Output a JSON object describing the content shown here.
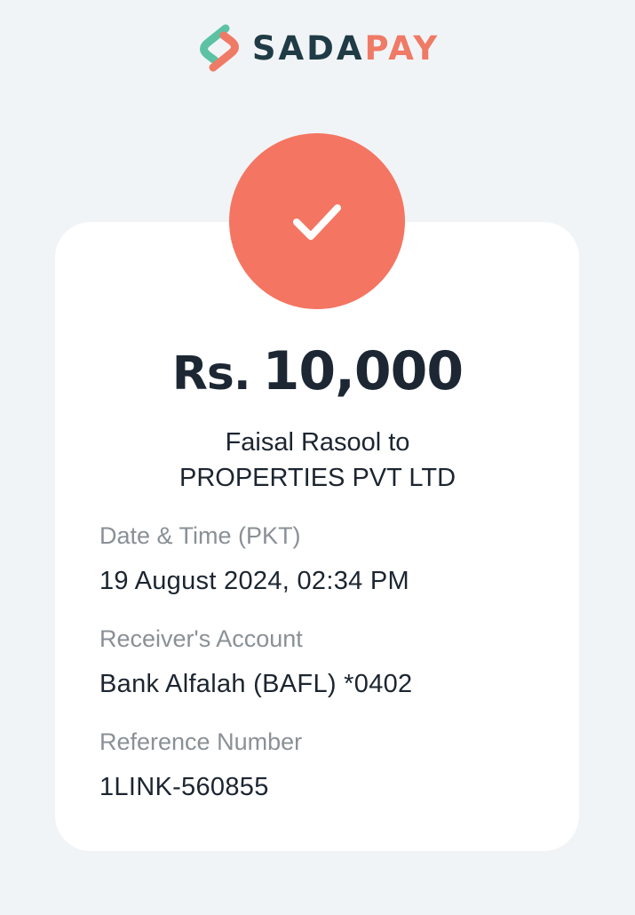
{
  "brand": {
    "logo_part_1": "SADA",
    "logo_part_2": "PAY",
    "primary_color": "#1f3b46",
    "accent_color": "#ef7a66",
    "logo_teal": "#5cc2a3"
  },
  "status": {
    "icon": "check-icon",
    "color": "#f47562"
  },
  "transaction": {
    "currency": "Rs.",
    "amount": "10,000",
    "sender": "Faisal Rasool",
    "connector": "to",
    "receiver": "PROPERTIES PVT LTD"
  },
  "details": [
    {
      "label": "Date & Time (PKT)",
      "value": "19 August 2024, 02:34 PM"
    },
    {
      "label": "Receiver's Account",
      "value": "Bank Alfalah (BAFL) *0402"
    },
    {
      "label": "Reference Number",
      "value": "1LINK-560855"
    }
  ]
}
